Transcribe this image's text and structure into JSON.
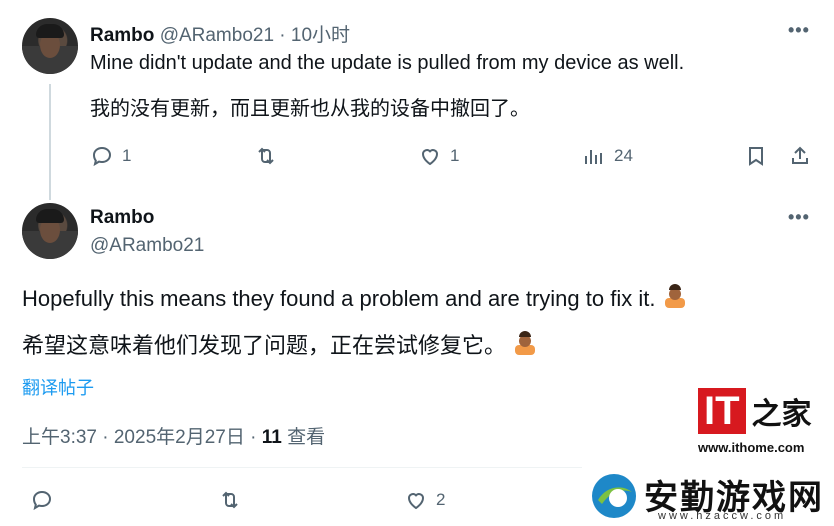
{
  "reply": {
    "name": "Rambo",
    "handle": "@ARambo21",
    "sep": " · ",
    "time": "10小时",
    "text_en": "Mine didn't update and the update is pulled from my device as well.",
    "text_zh": "我的没有更新，而且更新也从我的设备中撤回了。",
    "actions": {
      "replies": "1",
      "likes": "1",
      "views": "24"
    }
  },
  "main": {
    "name": "Rambo",
    "handle": "@ARambo21",
    "text_en": "Hopefully this means they found a problem and are trying to fix it.",
    "text_zh": "希望这意味着他们发现了问题，正在尝试修复它。",
    "translate_label": "翻译帖子",
    "meta": {
      "time": "上午3:37 · 2025年2月27日 · ",
      "views_count": "11",
      "views_label": " 查看"
    },
    "actions": {
      "likes": "2"
    }
  },
  "watermark": {
    "it_logo": "IT之家",
    "it_url": "www.ithome.com",
    "site_name": "安勤游戏网",
    "site_url": "www.hzaccw.com"
  },
  "icons": [
    "more-icon",
    "reply-icon",
    "retweet-icon",
    "like-icon",
    "views-icon",
    "bookmark-icon",
    "share-icon",
    "shrug-emoji"
  ]
}
